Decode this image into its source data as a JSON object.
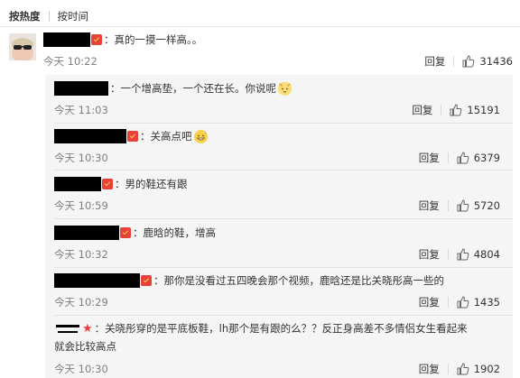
{
  "sort_tabs": [
    "按热度",
    "按时间"
  ],
  "main_comment": {
    "text": "：真的一摸一样高。。",
    "time": "今天 10:22",
    "reply_label": "回复",
    "likes": "31436"
  },
  "replies": [
    {
      "text": "：一个增高垫，一个还在长。你说呢",
      "time": "今天 11:03",
      "reply_label": "回复",
      "likes": "15191",
      "emoji": "cat"
    },
    {
      "text": "：关高点吧",
      "time": "今天 10:30",
      "reply_label": "回复",
      "likes": "6379",
      "emoji": "sweat-smile"
    },
    {
      "text": "：男的鞋还有跟",
      "time": "今天 10:59",
      "reply_label": "回复",
      "likes": "5720"
    },
    {
      "text": "：鹿晗的鞋，增高",
      "time": "今天 10:32",
      "reply_label": "回复",
      "likes": "4804"
    },
    {
      "text": "：那你是没看过五四晚会那个视频，鹿晗还是比关晓彤高一些的",
      "time": "今天 10:29",
      "reply_label": "回复",
      "likes": "1435"
    },
    {
      "text": "：关晓彤穿的是平底板鞋，lh那个是有跟的么？？反正身高差不多情侣女生看起来",
      "text2": "就会比较高点",
      "time": "今天 10:30",
      "reply_label": "回复",
      "likes": "1902"
    }
  ],
  "colors": {
    "badge": "#e8403b",
    "meta_gray": "#808080",
    "reply_bg": "#f5f5f5"
  }
}
